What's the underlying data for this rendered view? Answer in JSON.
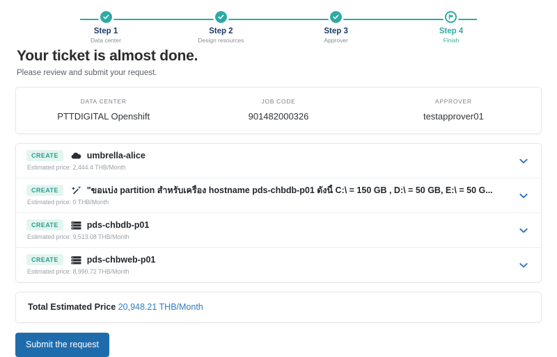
{
  "stepper": {
    "steps": [
      {
        "title": "Step 1",
        "sub": "Data center",
        "state": "done",
        "icon": "check-circle-icon"
      },
      {
        "title": "Step 2",
        "sub": "Design resources",
        "state": "done",
        "icon": "check-circle-icon"
      },
      {
        "title": "Step 3",
        "sub": "Approver",
        "state": "done",
        "icon": "check-circle-icon"
      },
      {
        "title": "Step 4",
        "sub": "Finish",
        "state": "current",
        "icon": "flag-circle-icon"
      }
    ],
    "accent_color": "#2eaaa4",
    "title_color": "#1a3a6b"
  },
  "heading": {
    "title": "Your ticket is almost done.",
    "subtitle": "Please review and submit your request."
  },
  "summary": {
    "columns": [
      {
        "label": "DATA CENTER",
        "value": "PTTDIGITAL Openshift"
      },
      {
        "label": "JOB CODE",
        "value": "901482000326"
      },
      {
        "label": "APPROVER",
        "value": "testapprover01"
      }
    ]
  },
  "resources": {
    "rows": [
      {
        "badge": "CREATE",
        "icon": "cloud-icon",
        "name": "umbrella-alice",
        "price": "Estimated price: 2,444.4 THB/Month",
        "chevron": "chevron-down-icon"
      },
      {
        "badge": "CREATE",
        "icon": "magic-wand-icon",
        "name": "\"ขอแบ่ง partition สำหรับเครื่อง hostname pds-chbdb-p01 ดังนี้ C:\\ = 150 GB , D:\\ = 50 GB, E:\\ = 50 G...",
        "price": "Estimated price: 0 THB/Month",
        "chevron": "chevron-down-icon"
      },
      {
        "badge": "CREATE",
        "icon": "server-icon",
        "name": "pds-chbdb-p01",
        "price": "Estimated price: 9,513.08 THB/Month",
        "chevron": "chevron-down-icon"
      },
      {
        "badge": "CREATE",
        "icon": "server-icon",
        "name": "pds-chbweb-p01",
        "price": "Estimated price: 8,990.72 THB/Month",
        "chevron": "chevron-down-icon"
      }
    ]
  },
  "total": {
    "label": "Total Estimated Price",
    "amount": "20,948.21 THB/Month",
    "amount_color": "#2f7cc4"
  },
  "submit": {
    "label": "Submit the request",
    "color": "#1f6cad"
  }
}
